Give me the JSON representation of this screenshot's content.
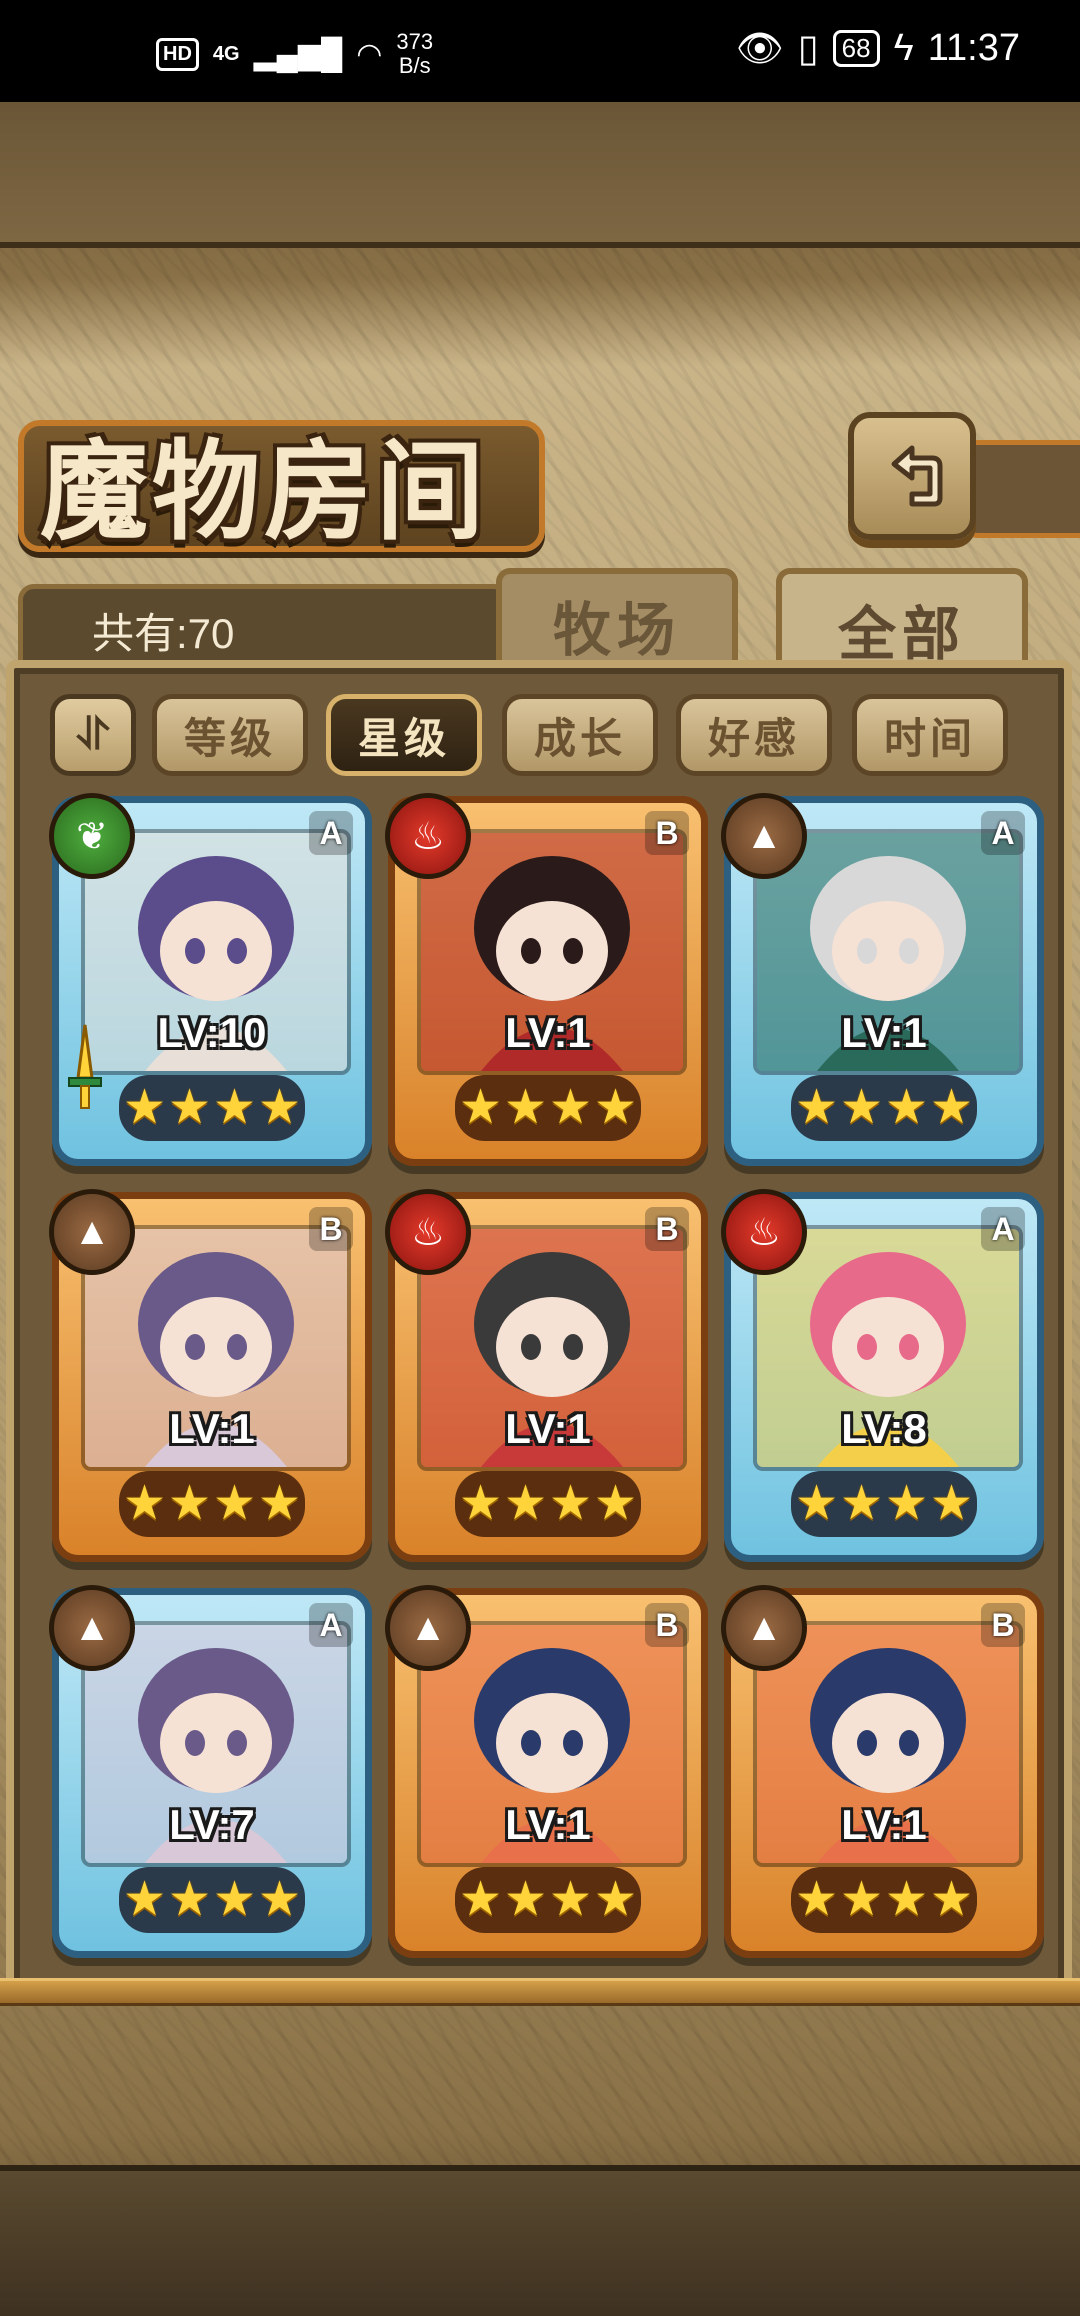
{
  "status_bar": {
    "hd": "HD",
    "network": "4G",
    "speed_value": "373",
    "speed_unit": "B/s",
    "battery": "68",
    "time": "11:37"
  },
  "title": "魔物房间",
  "count_label": "共有:70",
  "tabs": [
    "牧场",
    "全部"
  ],
  "active_tab": "全部",
  "filters": [
    "等级",
    "星级",
    "成长",
    "好感",
    "时间"
  ],
  "active_filter": "星级",
  "monsters": [
    {
      "element": "nature",
      "rank": "A",
      "level": "LV:10",
      "stars": 4,
      "has_weapon": true,
      "colors": [
        "#5b4c8c",
        "#e8e0d8"
      ]
    },
    {
      "element": "fire",
      "rank": "B",
      "level": "LV:1",
      "stars": 4,
      "has_weapon": false,
      "colors": [
        "#2a1a1a",
        "#b02a2a"
      ]
    },
    {
      "element": "earth",
      "rank": "A",
      "level": "LV:1",
      "stars": 4,
      "has_weapon": false,
      "colors": [
        "#d8d8d8",
        "#2a6a5a"
      ]
    },
    {
      "element": "earth",
      "rank": "B",
      "level": "LV:1",
      "stars": 4,
      "has_weapon": false,
      "colors": [
        "#6a5a8a",
        "#d8c8d8"
      ]
    },
    {
      "element": "fire",
      "rank": "B",
      "level": "LV:1",
      "stars": 4,
      "has_weapon": false,
      "colors": [
        "#3a3a3a",
        "#c83a3a"
      ]
    },
    {
      "element": "fire",
      "rank": "A",
      "level": "LV:8",
      "stars": 4,
      "has_weapon": false,
      "colors": [
        "#e86a8a",
        "#f4d04a"
      ]
    },
    {
      "element": "earth",
      "rank": "A",
      "level": "LV:7",
      "stars": 4,
      "has_weapon": false,
      "colors": [
        "#6a5a8a",
        "#d8c8d8"
      ]
    },
    {
      "element": "earth",
      "rank": "B",
      "level": "LV:1",
      "stars": 4,
      "has_weapon": false,
      "colors": [
        "#2a3a6a",
        "#e8704a"
      ]
    },
    {
      "element": "earth",
      "rank": "B",
      "level": "LV:1",
      "stars": 4,
      "has_weapon": false,
      "colors": [
        "#2a3a6a",
        "#e8704a"
      ]
    }
  ]
}
